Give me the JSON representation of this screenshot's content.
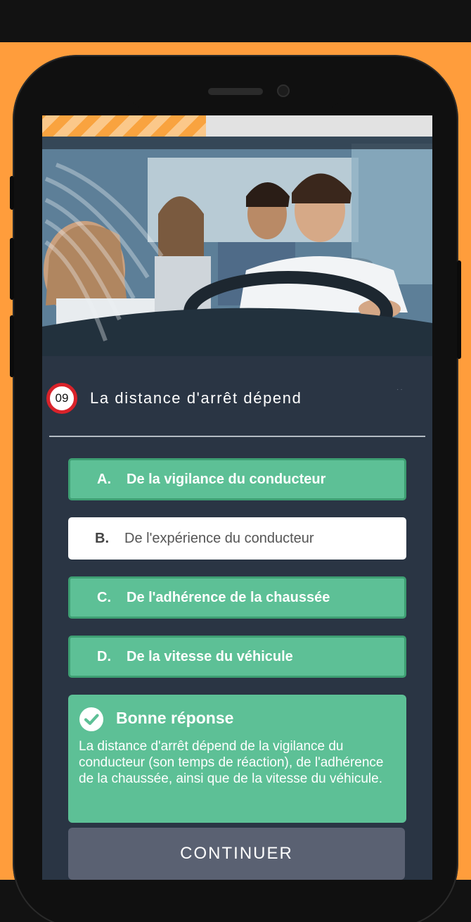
{
  "colors": {
    "background": "#FF9D3C",
    "screen": "#2A3544",
    "correct_green": "#5DC096",
    "number_ring_red": "#D9222A",
    "continue_button": "#5A6172"
  },
  "progress": {
    "fraction": 0.42
  },
  "question": {
    "number": "09",
    "text": "La distance d'arrêt dépend"
  },
  "answers": [
    {
      "letter": "A.",
      "text": "De la vigilance du conducteur",
      "state": "correct"
    },
    {
      "letter": "B.",
      "text": "De l'expérience du conducteur",
      "state": "neutral"
    },
    {
      "letter": "C.",
      "text": "De l'adhérence de la chaussée",
      "state": "correct"
    },
    {
      "letter": "D.",
      "text": "De la vitesse du véhicule",
      "state": "correct"
    }
  ],
  "feedback": {
    "icon": "check-circle-icon",
    "title": "Bonne réponse",
    "body": "La distance d'arrêt dépend de la vigilance du conducteur (son temps de réaction), de l'adhérence de la chaussée, ainsi que de la vitesse du véhicule."
  },
  "continue_label": "CONTINUER"
}
